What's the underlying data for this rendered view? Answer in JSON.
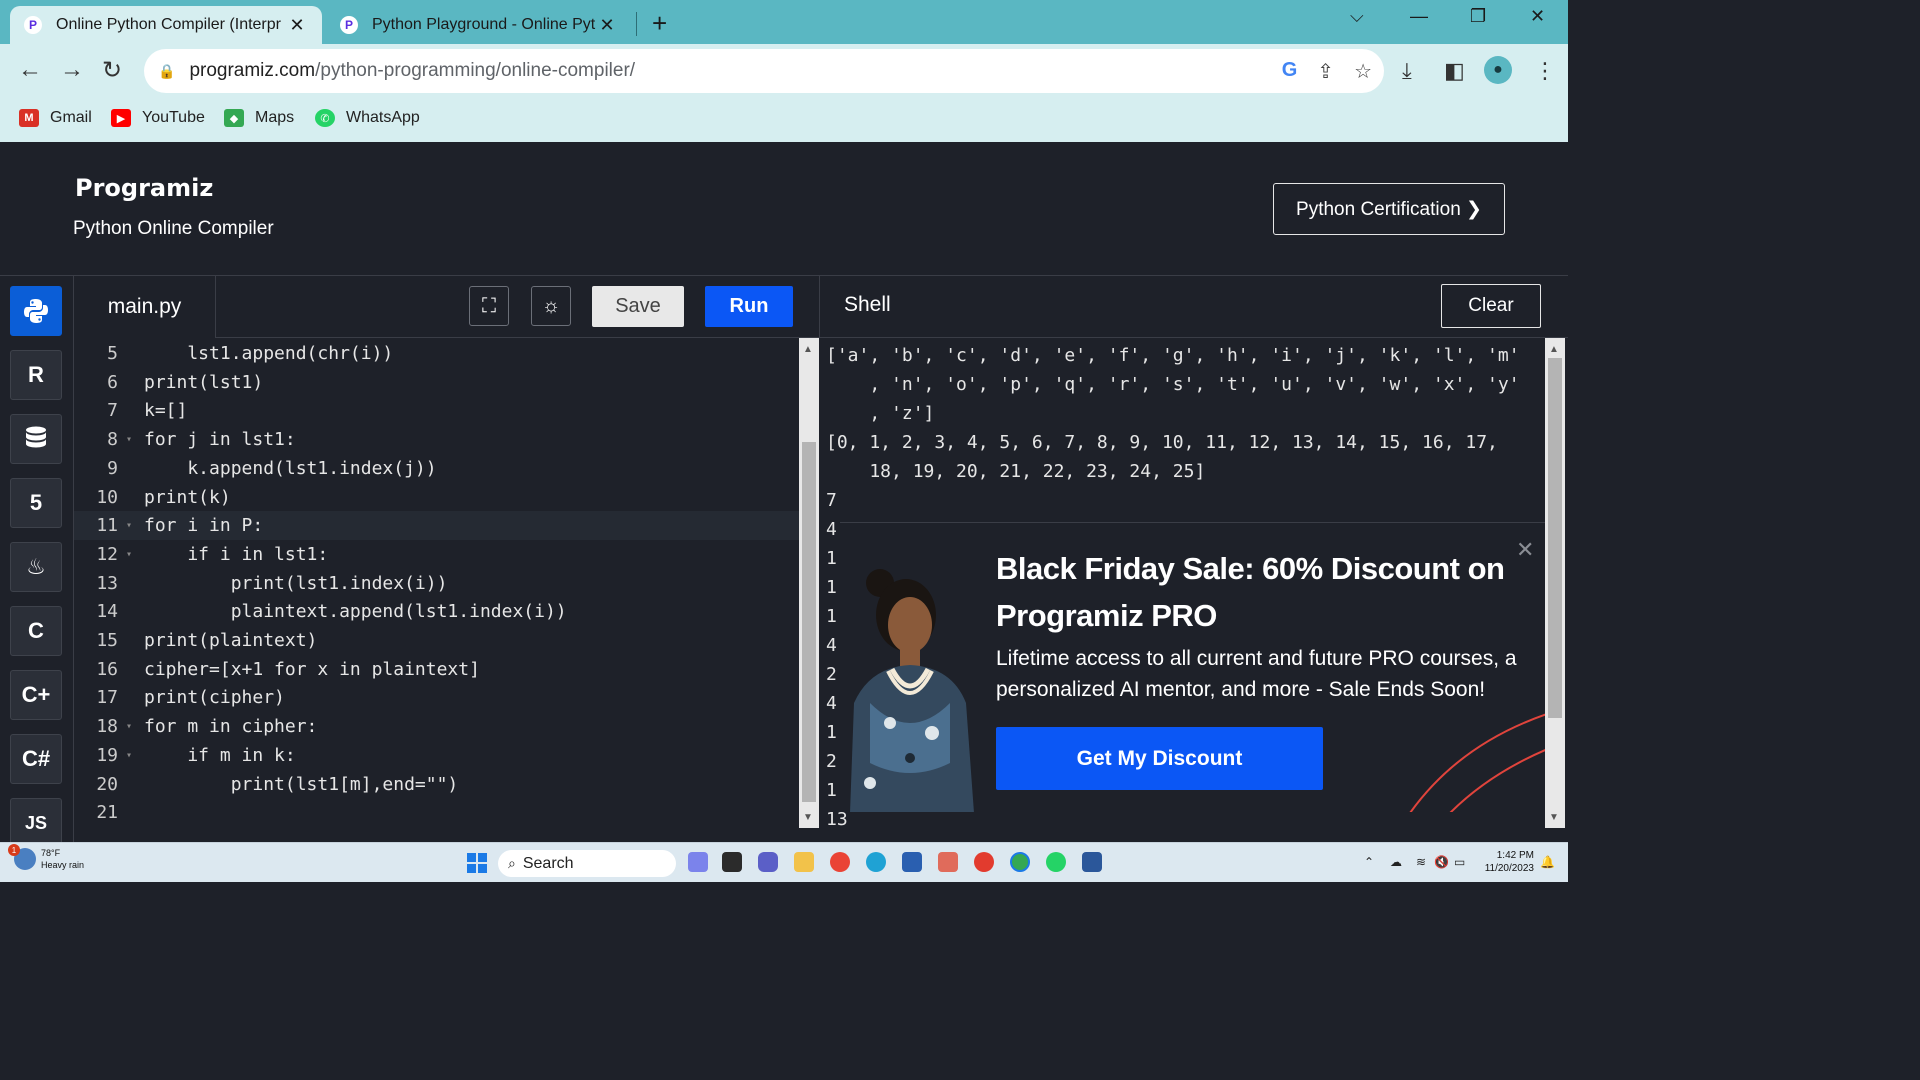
{
  "browser": {
    "tabs": [
      {
        "title": "Online Python Compiler (Interpr",
        "active": true
      },
      {
        "title": "Python Playground - Online Pytl",
        "active": false
      }
    ],
    "url_host": "programiz.com",
    "url_path": "/python-programming/online-compiler/",
    "bookmarks": [
      {
        "label": "Gmail",
        "icon": "gmail-icon",
        "color": "#d93025"
      },
      {
        "label": "YouTube",
        "icon": "youtube-icon",
        "color": "#ff0000"
      },
      {
        "label": "Maps",
        "icon": "maps-icon",
        "color": "#34a853"
      },
      {
        "label": "WhatsApp",
        "icon": "whatsapp-icon",
        "color": "#25d366"
      }
    ]
  },
  "site": {
    "logo": "Programiz",
    "subtitle": "Python Online Compiler",
    "cert_button": "Python Certification ❯"
  },
  "languages": [
    "python",
    "r",
    "sql",
    "html",
    "java",
    "c",
    "cpp",
    "csharp",
    "JS"
  ],
  "editor": {
    "file_name": "main.py",
    "save_label": "Save",
    "run_label": "Run",
    "lines": [
      {
        "n": "5",
        "code": "    lst1.append(chr(i))",
        "fold": false
      },
      {
        "n": "6",
        "code": "print(lst1)",
        "fold": false
      },
      {
        "n": "7",
        "code": "k=[]",
        "fold": false
      },
      {
        "n": "8",
        "code": "for j in lst1:",
        "fold": true
      },
      {
        "n": "9",
        "code": "    k.append(lst1.index(j))",
        "fold": false
      },
      {
        "n": "10",
        "code": "print(k)",
        "fold": false
      },
      {
        "n": "11",
        "code": "for i in P:",
        "fold": true
      },
      {
        "n": "12",
        "code": "    if i in lst1:",
        "fold": true
      },
      {
        "n": "13",
        "code": "        print(lst1.index(i))",
        "fold": false
      },
      {
        "n": "14",
        "code": "        plaintext.append(lst1.index(i))",
        "fold": false
      },
      {
        "n": "15",
        "code": "print(plaintext)",
        "fold": false
      },
      {
        "n": "16",
        "code": "cipher=[x+1 for x in plaintext]",
        "fold": false
      },
      {
        "n": "17",
        "code": "print(cipher)",
        "fold": false
      },
      {
        "n": "18",
        "code": "for m in cipher:",
        "fold": true
      },
      {
        "n": "19",
        "code": "    if m in k:",
        "fold": true
      },
      {
        "n": "20",
        "code": "        print(lst1[m],end=\"\")",
        "fold": false
      },
      {
        "n": "21",
        "code": "",
        "fold": false
      }
    ]
  },
  "shell": {
    "title": "Shell",
    "clear_label": "Clear",
    "output": [
      "['a', 'b', 'c', 'd', 'e', 'f', 'g', 'h', 'i', 'j', 'k', 'l', 'm'",
      "    , 'n', 'o', 'p', 'q', 'r', 's', 't', 'u', 'v', 'w', 'x', 'y'",
      "    , 'z']",
      "[0, 1, 2, 3, 4, 5, 6, 7, 8, 9, 10, 11, 12, 13, 14, 15, 16, 17,",
      "    18, 19, 20, 21, 22, 23, 24, 25]",
      "7",
      "4",
      "1",
      "1",
      "1",
      "4",
      "2",
      "4",
      "1",
      "2",
      "1",
      "13"
    ]
  },
  "promo": {
    "title": "Black Friday Sale: 60% Discount on Programiz PRO",
    "description": "Lifetime access to all current and future PRO courses, a personalized AI mentor, and more - Sale Ends Soon!",
    "cta": "Get My Discount"
  },
  "taskbar": {
    "temperature": "78°F",
    "condition": "Heavy rain",
    "weather_badge": "1",
    "search_placeholder": "Search",
    "time": "1:42 PM",
    "date": "11/20/2023"
  }
}
